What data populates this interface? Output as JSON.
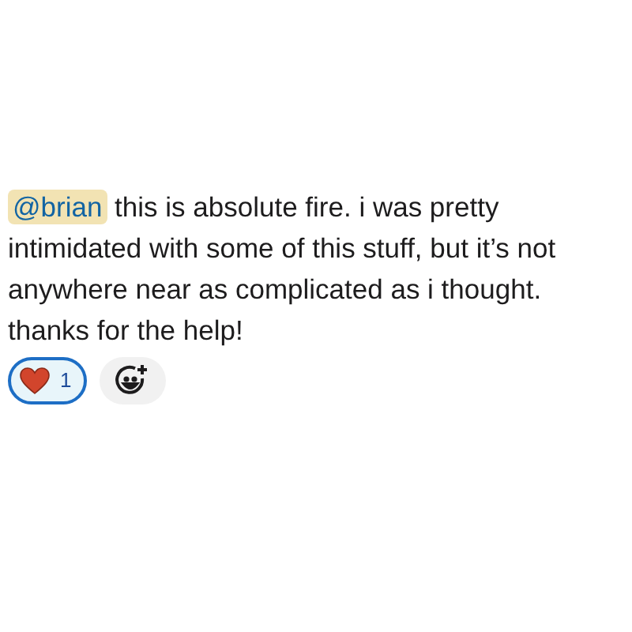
{
  "message": {
    "mention": "@brian",
    "text": " this is absolute fire. i was pretty intimidated with some of this stuff, but it’s not anywhere near as complicated as i thought. thanks for the help!"
  },
  "reactions": [
    {
      "count": "1",
      "selected": true
    }
  ]
}
